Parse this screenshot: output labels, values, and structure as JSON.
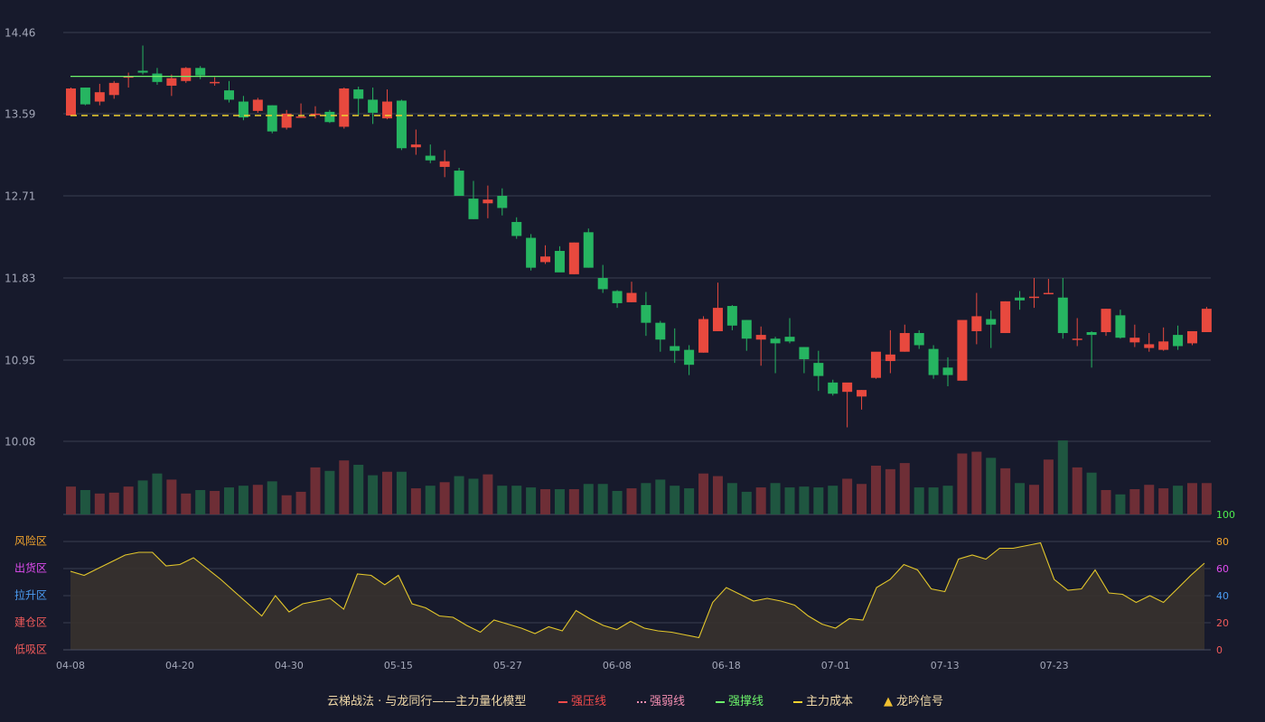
{
  "colors": {
    "background": "#171a2c",
    "up": "#e8493e",
    "down": "#26b561",
    "volume_up": "#6e2e36",
    "volume_down": "#1f5640",
    "support_line": "#6cf46a",
    "cost_line": "#f0d130",
    "osc_line": "#e3c72b",
    "osc_fill": "#37322d",
    "grid": "#3a3d51",
    "axis_text": "#a3a7b8",
    "zone_risk": "#f0a32d",
    "zone_distribute": "#e04cf0",
    "zone_rise": "#4b9cf2",
    "zone_build": "#f05a5a",
    "zone_low": "#f05a5a",
    "tick_100": "#4ef04e",
    "tick_80": "#f0a32d",
    "tick_60": "#e04cf0",
    "tick_40": "#4b9cf2",
    "tick_20": "#f05a5a",
    "tick_0": "#f05a5a",
    "legend_title": "#f0d9a8",
    "legend_strong_resist": "#f24b4b",
    "legend_weak": "#f18db0",
    "legend_support": "#6cf46a",
    "legend_cost": "#f0d130",
    "legend_signal": "#f0c030"
  },
  "chart_data": [
    {
      "type": "candlestick",
      "panel": "price",
      "y_ticks": [
        "14.46",
        "13.59",
        "12.71",
        "11.83",
        "10.95",
        "10.08"
      ],
      "ylim": [
        10.08,
        14.46
      ],
      "x_tick_labels": [
        {
          "index": 0,
          "label": "04-08"
        },
        {
          "index": 8,
          "label": "04-20"
        },
        {
          "index": 16,
          "label": "04-30"
        },
        {
          "index": 24,
          "label": "05-15"
        },
        {
          "index": 32,
          "label": "05-27"
        },
        {
          "index": 40,
          "label": "06-08"
        },
        {
          "index": 48,
          "label": "06-18"
        },
        {
          "index": 56,
          "label": "07-01"
        },
        {
          "index": 64,
          "label": "07-13"
        },
        {
          "index": 72,
          "label": "07-23"
        }
      ],
      "ohlc": [
        [
          13.57,
          13.87,
          13.57,
          13.86
        ],
        [
          13.87,
          13.87,
          13.68,
          13.69
        ],
        [
          13.72,
          13.91,
          13.68,
          13.82
        ],
        [
          13.79,
          13.94,
          13.75,
          13.92
        ],
        [
          13.98,
          14.03,
          13.87,
          13.99
        ],
        [
          14.05,
          14.32,
          14.01,
          14.03
        ],
        [
          14.02,
          14.08,
          13.9,
          13.93
        ],
        [
          13.89,
          14.01,
          13.78,
          13.97
        ],
        [
          13.94,
          14.09,
          13.92,
          14.08
        ],
        [
          14.08,
          14.1,
          13.96,
          14.0
        ],
        [
          13.92,
          13.98,
          13.89,
          13.93
        ],
        [
          13.84,
          13.94,
          13.71,
          13.74
        ],
        [
          13.72,
          13.78,
          13.52,
          13.55
        ],
        [
          13.62,
          13.76,
          13.6,
          13.74
        ],
        [
          13.68,
          13.68,
          13.38,
          13.4
        ],
        [
          13.44,
          13.63,
          13.42,
          13.59
        ],
        [
          13.55,
          13.7,
          13.55,
          13.56
        ],
        [
          13.58,
          13.67,
          13.54,
          13.59
        ],
        [
          13.61,
          13.63,
          13.49,
          13.5
        ],
        [
          13.45,
          13.87,
          13.43,
          13.86
        ],
        [
          13.85,
          13.88,
          13.57,
          13.75
        ],
        [
          13.74,
          13.87,
          13.48,
          13.6
        ],
        [
          13.54,
          13.85,
          13.53,
          13.72
        ],
        [
          13.73,
          13.74,
          13.2,
          13.22
        ],
        [
          13.23,
          13.42,
          13.15,
          13.26
        ],
        [
          13.14,
          13.26,
          13.06,
          13.09
        ],
        [
          13.02,
          13.2,
          12.91,
          13.08
        ],
        [
          12.98,
          13.01,
          12.71,
          12.71
        ],
        [
          12.68,
          12.87,
          12.46,
          12.46
        ],
        [
          12.63,
          12.82,
          12.47,
          12.67
        ],
        [
          12.71,
          12.79,
          12.5,
          12.58
        ],
        [
          12.43,
          12.48,
          12.25,
          12.28
        ],
        [
          12.26,
          12.3,
          11.91,
          11.94
        ],
        [
          12.0,
          12.18,
          11.98,
          12.06
        ],
        [
          12.12,
          12.17,
          11.9,
          11.89
        ],
        [
          11.87,
          12.21,
          11.87,
          12.21
        ],
        [
          12.32,
          12.36,
          11.94,
          11.94
        ],
        [
          11.83,
          11.97,
          11.67,
          11.71
        ],
        [
          11.69,
          11.7,
          11.51,
          11.56
        ],
        [
          11.57,
          11.79,
          11.57,
          11.67
        ],
        [
          11.54,
          11.68,
          11.21,
          11.35
        ],
        [
          11.35,
          11.37,
          11.04,
          11.17
        ],
        [
          11.1,
          11.29,
          10.92,
          11.05
        ],
        [
          11.06,
          11.11,
          10.79,
          10.9
        ],
        [
          11.03,
          11.42,
          11.03,
          11.39
        ],
        [
          11.26,
          11.78,
          11.26,
          11.51
        ],
        [
          11.53,
          11.54,
          11.27,
          11.32
        ],
        [
          11.38,
          11.38,
          11.05,
          11.18
        ],
        [
          11.17,
          11.31,
          10.89,
          11.22
        ],
        [
          11.18,
          11.2,
          10.81,
          11.13
        ],
        [
          11.2,
          11.4,
          11.13,
          11.15
        ],
        [
          11.09,
          11.09,
          10.81,
          10.96
        ],
        [
          10.92,
          11.05,
          10.62,
          10.78
        ],
        [
          10.71,
          10.74,
          10.57,
          10.59
        ],
        [
          10.61,
          10.67,
          10.23,
          10.71
        ],
        [
          10.56,
          10.63,
          10.42,
          10.63
        ],
        [
          10.76,
          10.91,
          10.75,
          11.04
        ],
        [
          10.94,
          11.27,
          10.81,
          11.01
        ],
        [
          11.04,
          11.33,
          11.04,
          11.24
        ],
        [
          11.24,
          11.27,
          11.07,
          11.11
        ],
        [
          11.07,
          11.11,
          10.75,
          10.79
        ],
        [
          10.87,
          10.98,
          10.67,
          10.79
        ],
        [
          10.73,
          11.37,
          10.73,
          11.38
        ],
        [
          11.26,
          11.67,
          11.12,
          11.42
        ],
        [
          11.39,
          11.48,
          11.08,
          11.33
        ],
        [
          11.24,
          11.58,
          11.24,
          11.58
        ],
        [
          11.62,
          11.69,
          11.49,
          11.59
        ],
        [
          11.62,
          11.83,
          11.51,
          11.63
        ],
        [
          11.66,
          11.82,
          11.66,
          11.67
        ],
        [
          11.62,
          11.83,
          11.18,
          11.24
        ],
        [
          11.18,
          11.4,
          11.1,
          11.18
        ],
        [
          11.25,
          11.26,
          10.87,
          11.22
        ],
        [
          11.25,
          11.5,
          11.21,
          11.5
        ],
        [
          11.43,
          11.49,
          11.18,
          11.19
        ],
        [
          11.14,
          11.33,
          11.09,
          11.19
        ],
        [
          11.08,
          11.24,
          11.04,
          11.12
        ],
        [
          11.06,
          11.3,
          11.05,
          11.15
        ],
        [
          11.22,
          11.32,
          11.06,
          11.1
        ],
        [
          11.13,
          11.24,
          11.11,
          11.26
        ],
        [
          11.25,
          11.52,
          11.25,
          11.5
        ]
      ],
      "volume": [
        32,
        28,
        24,
        25,
        32,
        39,
        47,
        40,
        24,
        28,
        27,
        31,
        33,
        34,
        38,
        22,
        26,
        54,
        50,
        62,
        57,
        45,
        49,
        49,
        30,
        33,
        37,
        44,
        41,
        46,
        33,
        33,
        31,
        29,
        29,
        29,
        35,
        35,
        27,
        30,
        36,
        40,
        33,
        30,
        47,
        44,
        36,
        26,
        31,
        36,
        31,
        32,
        31,
        33,
        41,
        35,
        56,
        52,
        59,
        31,
        31,
        33,
        70,
        72,
        65,
        53,
        36,
        34,
        63,
        85,
        54,
        48,
        28,
        23,
        29,
        34,
        30,
        33,
        36,
        36
      ],
      "reference_lines": {
        "support": 13.99,
        "cost": 13.57
      }
    },
    {
      "type": "area",
      "panel": "oscillator",
      "ylim": [
        0,
        100
      ],
      "y_ticks": [
        "100",
        "80",
        "60",
        "40",
        "20",
        "0"
      ],
      "zone_labels": [
        "风险区",
        "出货区",
        "拉升区",
        "建仓区",
        "低吸区"
      ],
      "values": [
        58,
        55,
        60,
        65,
        70,
        72,
        72,
        62,
        63,
        68,
        60,
        52,
        43,
        34,
        25,
        40,
        28,
        34,
        36,
        38,
        30,
        56,
        55,
        48,
        55,
        34,
        31,
        25,
        24,
        18,
        13,
        22,
        19,
        16,
        12,
        17,
        14,
        29,
        23,
        18,
        15,
        21,
        16,
        14,
        13,
        11,
        9,
        35,
        46,
        41,
        36,
        38,
        36,
        33,
        25,
        19,
        16,
        23,
        22,
        46,
        52,
        63,
        59,
        45,
        43,
        67,
        70,
        67,
        75,
        75,
        77,
        79,
        52,
        44,
        45,
        59,
        42,
        41,
        35,
        40,
        35,
        45,
        55,
        64
      ]
    }
  ],
  "legend": {
    "title": "云梯战法 · 与龙同行——主力量化模型",
    "strong_resist": "强压线",
    "weak": "强弱线",
    "support": "强撑线",
    "cost": "主力成本",
    "signal": "龙吟信号",
    "signal_symbol": "▲"
  }
}
